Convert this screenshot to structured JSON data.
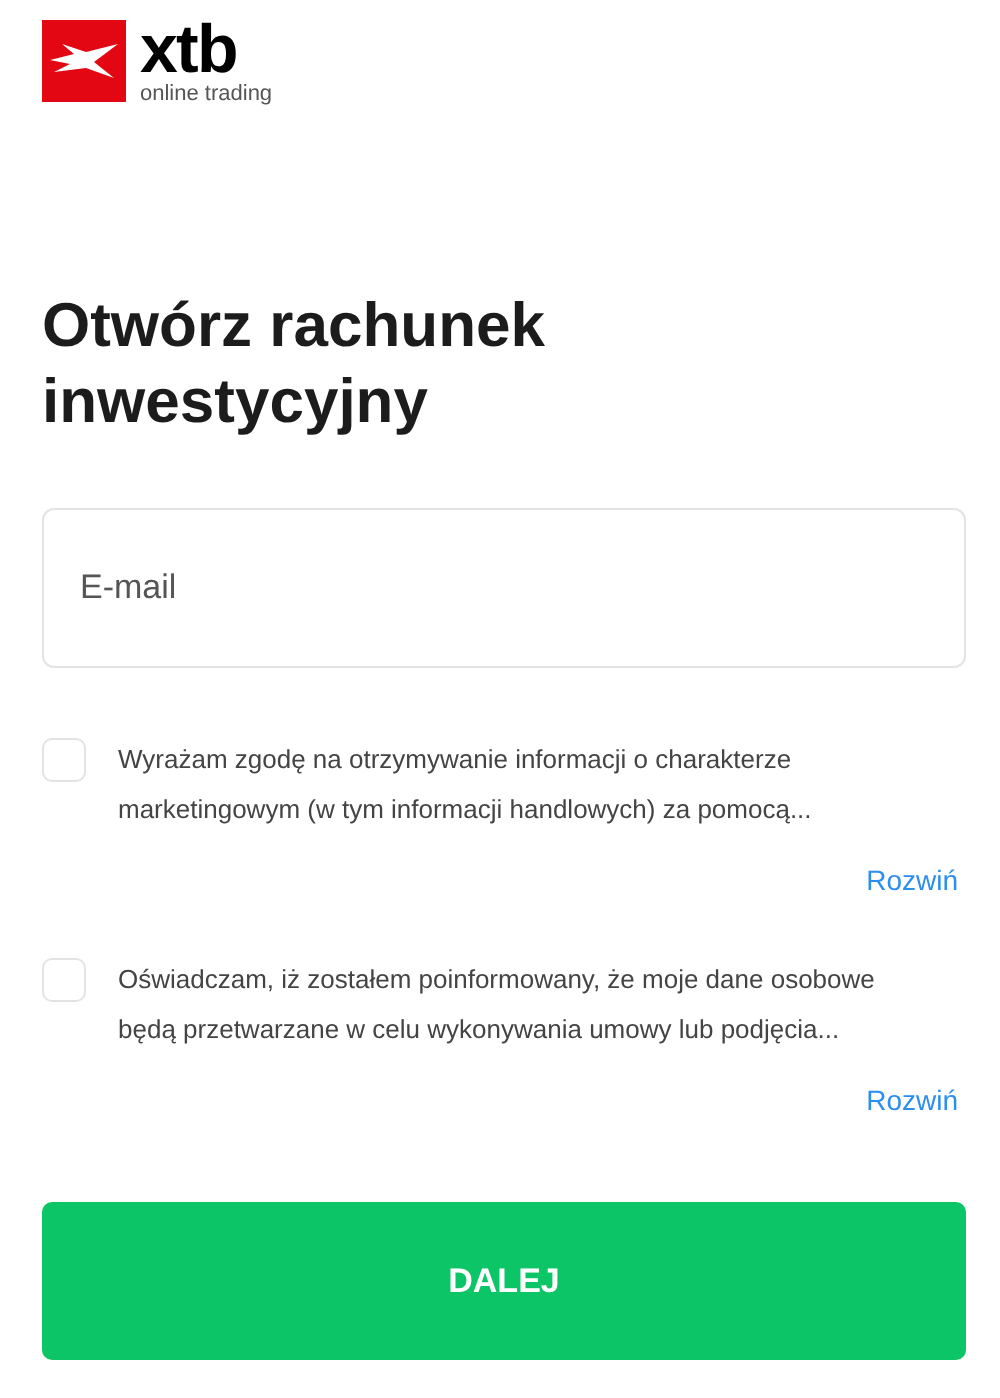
{
  "logo": {
    "wordmark": "xtb",
    "tagline": "online trading"
  },
  "heading": "Otwórz rachunek inwestycyjny",
  "email": {
    "placeholder": "E-mail"
  },
  "consents": [
    {
      "text": "Wyrażam zgodę na otrzymywanie informacji o charakterze\nmarketingowym (w tym informacji handlowych) za pomocą...",
      "checked": false,
      "expand": "Rozwiń"
    },
    {
      "text": "Oświadczam, iż zostałem poinformowany, że moje dane osobowe\nbędą przetwarzane w celu wykonywania umowy lub podjęcia...",
      "checked": false,
      "expand": "Rozwiń"
    }
  ],
  "submit": "DALEJ"
}
